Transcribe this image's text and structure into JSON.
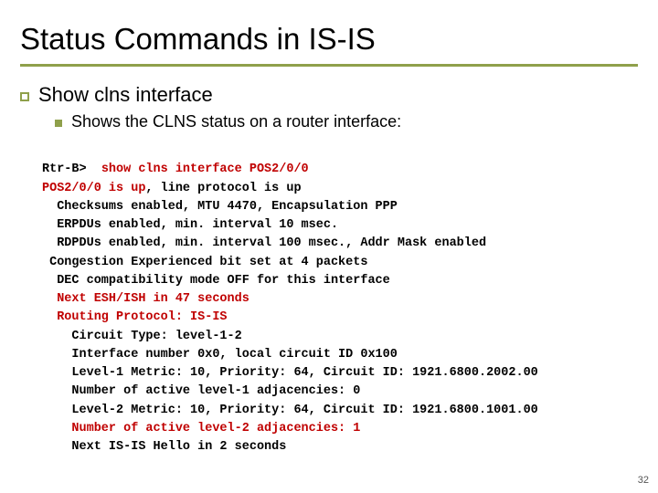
{
  "title": "Status Commands in IS-IS",
  "bullet1": "Show clns interface",
  "sub1": "Shows the CLNS status on a router interface:",
  "term": {
    "l1a": "Rtr-B>  ",
    "l1b": "show clns interface POS2/0/0",
    "l2a": "POS2/0/0 is up",
    "l2b": ", line protocol is up",
    "l3": "  Checksums enabled, MTU 4470, Encapsulation PPP",
    "l4": "  ERPDUs enabled, min. interval 10 msec.",
    "l5": "  RDPDUs enabled, min. interval 100 msec., Addr Mask enabled",
    "l6": " Congestion Experienced bit set at 4 packets",
    "l7": "  DEC compatibility mode OFF for this interface",
    "l8": "  Next ESH/ISH in 47 seconds",
    "l9": "  Routing Protocol: IS-IS",
    "l10": "    Circuit Type: level-1-2",
    "l11": "    Interface number 0x0, local circuit ID 0x100",
    "l12": "    Level-1 Metric: 10, Priority: 64, Circuit ID: 1921.6800.2002.00",
    "l13": "    Number of active level-1 adjacencies: 0",
    "l14": "    Level-2 Metric: 10, Priority: 64, Circuit ID: 1921.6800.1001.00",
    "l15": "    Number of active level-2 adjacencies: 1",
    "l16": "    Next IS-IS Hello in 2 seconds"
  },
  "page_number": "32"
}
